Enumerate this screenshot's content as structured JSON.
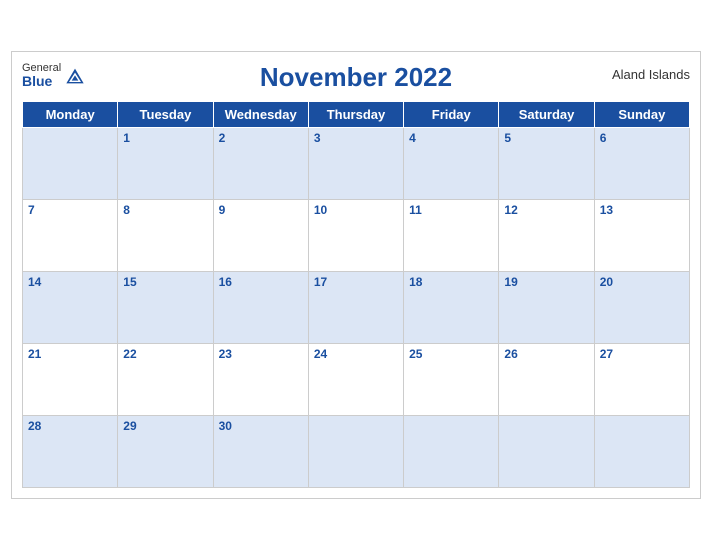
{
  "header": {
    "logo_general": "General",
    "logo_blue": "Blue",
    "month_title": "November 2022",
    "region": "Aland Islands"
  },
  "weekdays": [
    "Monday",
    "Tuesday",
    "Wednesday",
    "Thursday",
    "Friday",
    "Saturday",
    "Sunday"
  ],
  "weeks": [
    [
      "",
      "1",
      "2",
      "3",
      "4",
      "5",
      "6"
    ],
    [
      "7",
      "8",
      "9",
      "10",
      "11",
      "12",
      "13"
    ],
    [
      "14",
      "15",
      "16",
      "17",
      "18",
      "19",
      "20"
    ],
    [
      "21",
      "22",
      "23",
      "24",
      "25",
      "26",
      "27"
    ],
    [
      "28",
      "29",
      "30",
      "",
      "",
      "",
      ""
    ]
  ]
}
